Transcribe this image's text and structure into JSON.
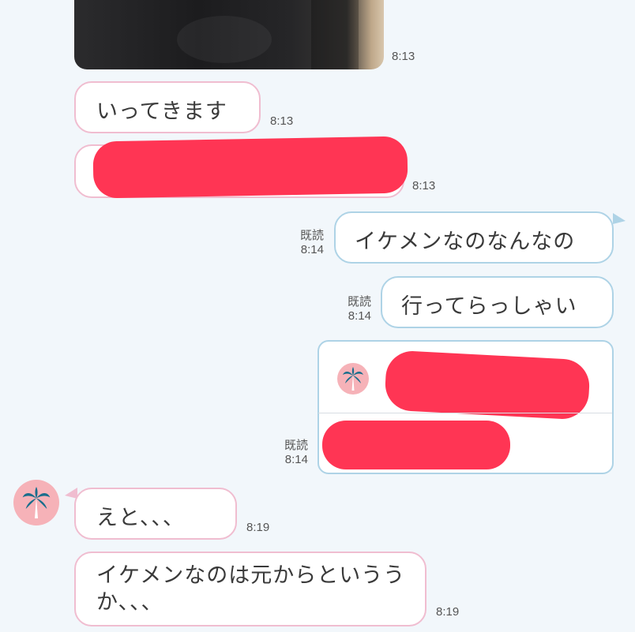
{
  "messages": {
    "photo_time": "8:13",
    "m1": {
      "text": "いってきます",
      "time": "8:13"
    },
    "m2": {
      "time": "8:13"
    },
    "m3": {
      "text": "イケメンなのなんなの",
      "read": "既読",
      "time": "8:14"
    },
    "m4": {
      "text": "行ってらっしゃい",
      "read": "既読",
      "time": "8:14"
    },
    "m5": {
      "read": "既読",
      "time": "8:14"
    },
    "m6": {
      "text": "えと、、、",
      "time": "8:19"
    },
    "m7": {
      "line1": "イケメンなのは元からというう",
      "line2": "か、、、",
      "time": "8:19"
    }
  },
  "icons": {
    "avatar": "palm-tree-icon"
  },
  "colors": {
    "redaction": "#ff3554",
    "incoming_border": "#f0bdd0",
    "outgoing_border": "#aed3e6",
    "avatar_bg": "#f6b2b8",
    "palm": "#1a6e8c"
  }
}
